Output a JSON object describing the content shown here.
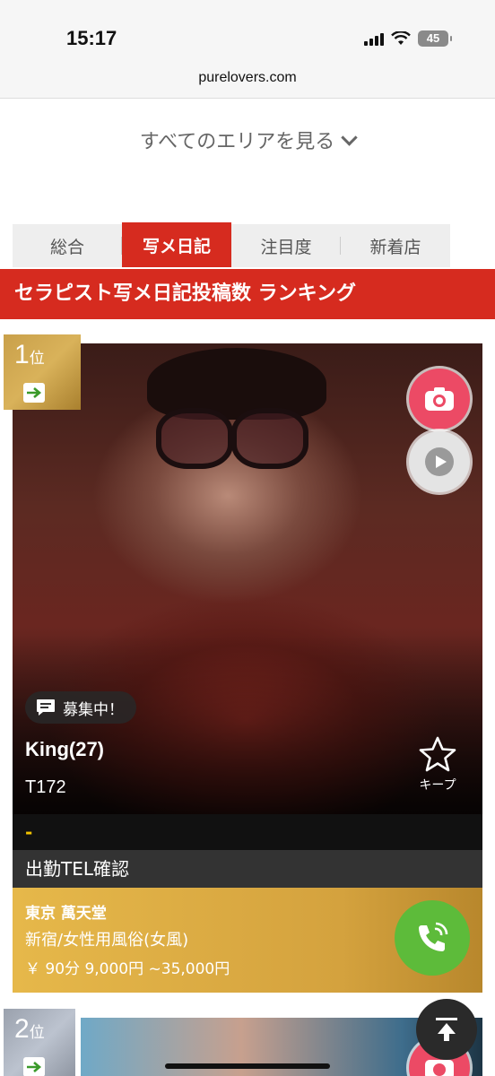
{
  "status_bar": {
    "time": "15:17",
    "battery": "45"
  },
  "browser": {
    "url": "purelovers.com"
  },
  "area_link": {
    "label": "すべてのエリアを見る"
  },
  "tabs": [
    {
      "label": "総合",
      "active": false
    },
    {
      "label": "写メ日記",
      "active": true
    },
    {
      "label": "注目度",
      "active": false
    },
    {
      "label": "新着店",
      "active": false
    }
  ],
  "ranking_title": "セラピスト写メ日記投稿数 ランキング",
  "cards": [
    {
      "rank_number": "1",
      "rank_suffix": "位",
      "recruit_label": "募集中！",
      "name": "King(27)",
      "height": "T172",
      "keep_label": "キープ",
      "dash": "-",
      "tel_label": "出勤TEL確認",
      "shop_name": "東京 萬天堂",
      "shop_category": "新宿/女性用風俗(女風)",
      "price": "￥ 90分 9,000円 ~35,000円"
    },
    {
      "rank_number": "2",
      "rank_suffix": "位"
    }
  ],
  "colors": {
    "accent": "#d62b1f",
    "gold": "#d4a23e",
    "silver": "#9aa1ad",
    "camera_pink": "#ec4a65",
    "call_green": "#5dbb3a",
    "dash_yellow": "#f2c200"
  },
  "icons": [
    "camera-icon",
    "play-icon",
    "chat-icon",
    "star-icon",
    "phone-icon",
    "arrow-up-icon",
    "chevron-down-icon",
    "rank-arrow-icon"
  ]
}
